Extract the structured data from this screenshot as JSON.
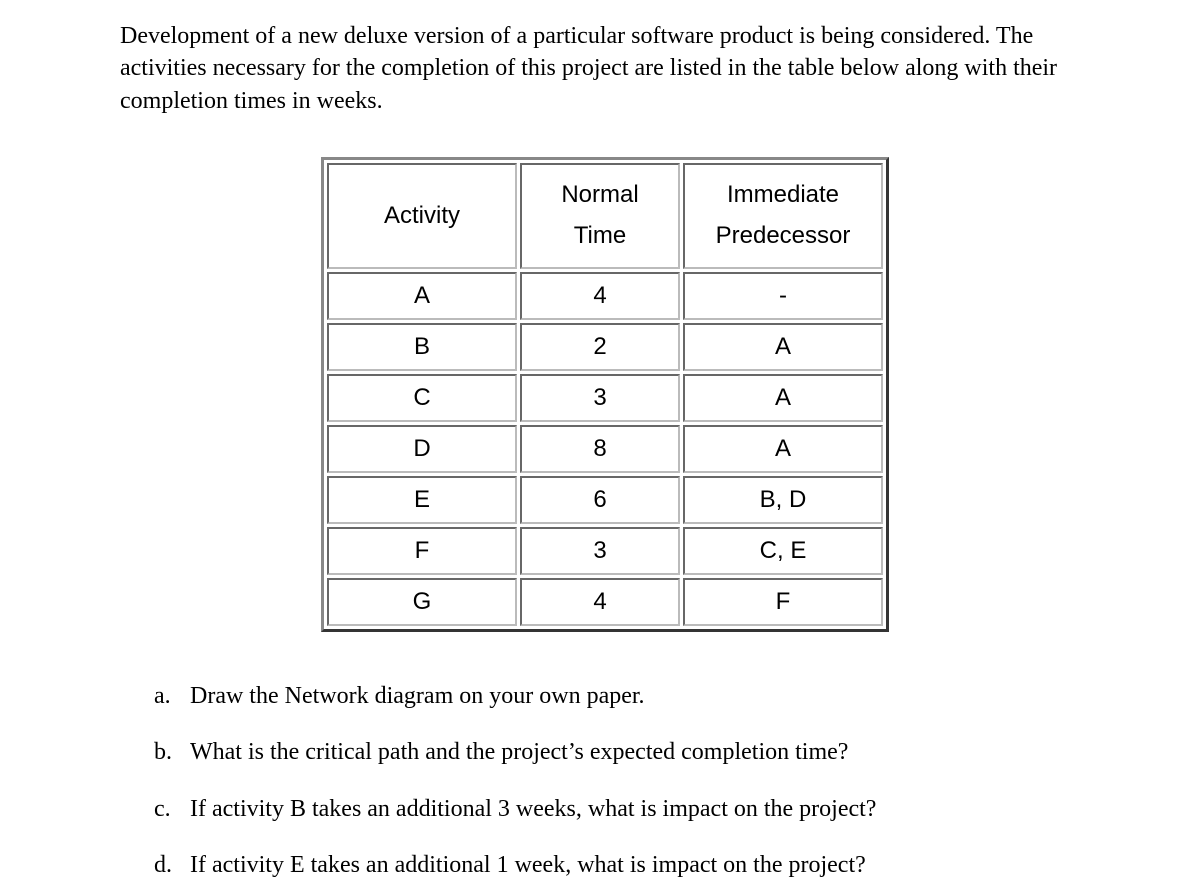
{
  "intro": "Development of a new deluxe version of a particular software product is being considered. The activities necessary for the completion of this project are listed in the table below along with their completion times in weeks.",
  "table": {
    "headers": {
      "activity": "Activity",
      "time": "Normal Time",
      "predecessor": "Immediate Predecessor"
    },
    "rows": [
      {
        "activity": "A",
        "time": "4",
        "predecessor": "-"
      },
      {
        "activity": "B",
        "time": "2",
        "predecessor": "A"
      },
      {
        "activity": "C",
        "time": "3",
        "predecessor": "A"
      },
      {
        "activity": "D",
        "time": "8",
        "predecessor": "A"
      },
      {
        "activity": "E",
        "time": "6",
        "predecessor": "B, D"
      },
      {
        "activity": "F",
        "time": "3",
        "predecessor": "C, E"
      },
      {
        "activity": "G",
        "time": "4",
        "predecessor": "F"
      }
    ]
  },
  "questions": [
    {
      "marker": "a.",
      "text": "Draw the Network diagram on your own paper."
    },
    {
      "marker": "b.",
      "text": "What is the critical path and the project’s expected completion time?"
    },
    {
      "marker": "c.",
      "text": "If activity B takes an additional 3 weeks, what is impact on the project?"
    },
    {
      "marker": "d.",
      "text": "If activity E takes an additional 1 week, what is impact on the project?"
    }
  ]
}
